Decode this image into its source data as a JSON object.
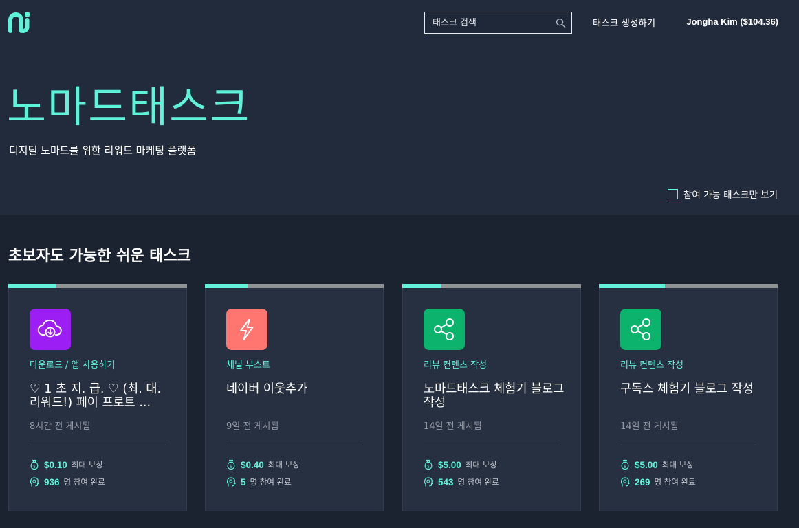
{
  "header": {
    "search_placeholder": "태스크 검색",
    "create_label": "태스크 생성하기",
    "user_label": "Jongha Kim ($104.36)"
  },
  "hero": {
    "title": "노마드태스크",
    "subtitle": "디지털 노마드를 위한 리워드 마케팅 플랫폼",
    "filter_label": "참여 가능 태스크만 보기",
    "filter_checked": false
  },
  "section": {
    "title": "초보자도 가능한 쉬운 태스크"
  },
  "cards": [
    {
      "progress": 0.27,
      "icon": "cloud-download-icon",
      "icon_color": "#9d1ef5",
      "category": "다운로드 / 앱 사용하기",
      "title": "♡ 1 초 지. 급. ♡ (최. 대. 리워드!) 페이 프로트 ...",
      "posted": "8시간 전 게시됨",
      "reward": "$0.10",
      "reward_label": "최대 보상",
      "count": "936",
      "count_label": "명 참여 완료"
    },
    {
      "progress": 0.24,
      "icon": "lightning-icon",
      "icon_color": "#ff7670",
      "category": "채널 부스트",
      "title": "네이버 이웃추가",
      "posted": "9일 전 게시됨",
      "reward": "$0.40",
      "reward_label": "최대 보상",
      "count": "5",
      "count_label": "명 참여 완료"
    },
    {
      "progress": 0.22,
      "icon": "share-icon",
      "icon_color": "#0bb36c",
      "category": "리뷰 컨텐츠 작성",
      "title": "노마드태스크 체험기 블로그 작성",
      "posted": "14일 전 게시됨",
      "reward": "$5.00",
      "reward_label": "최대 보상",
      "count": "543",
      "count_label": "명 참여 완료"
    },
    {
      "progress": 0.37,
      "icon": "share-icon",
      "icon_color": "#0bb36c",
      "category": "리뷰 컨텐츠 작성",
      "title": "구독스 체험기 블로그 작성",
      "posted": "14일 전 게시됨",
      "reward": "$5.00",
      "reward_label": "최대 보상",
      "count": "269",
      "count_label": "명 참여 완료"
    }
  ],
  "colors": {
    "accent": "#5ef2d9",
    "hero_bg": "#222b3b",
    "page_bg": "#1b2230",
    "card_bg": "#273041"
  }
}
